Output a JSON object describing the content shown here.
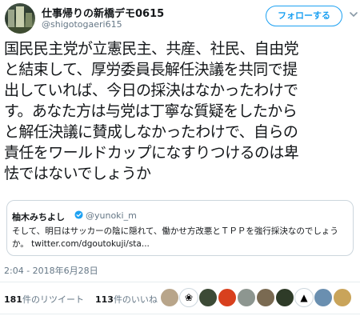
{
  "author": {
    "display_name": "仕事帰りの新橋デモ0615",
    "handle": "@shigotogaeri615"
  },
  "follow_button": {
    "label": "フォローする",
    "accent": "#1da1f2"
  },
  "tweet": {
    "text": "国民民主党が立憲民主、共産、社民、自由党\nと結束して、厚労委員長解任決議を共同で提\n出していれば、今日の採決はなかったわけで\nす。あなた方は与党は丁寧な質疑をしたから\nと解任決議に賛成しなかったわけで、自らの\n責任をワールドカップになすりつけるのは卑\n怯ではないでしょうか"
  },
  "quoted_tweet": {
    "name": "柚木みちよし",
    "handle": "@yunoki_m",
    "text": "そして、明日はサッカーの陰に隠れて、働かせ方改悪とＴＰＰを強行採決なのでしょう\nか。 twitter.com/dgoutokuji/sta..."
  },
  "timestamp": "2:04 - 2018年6月28日",
  "stats": {
    "retweet_count": "181",
    "retweet_label": "件のリツイート",
    "like_count": "113",
    "like_label": "件のいいね"
  },
  "likers": [
    {
      "icon": "liker-avatar-1",
      "color": "#b8a58a"
    },
    {
      "icon": "liker-avatar-paw",
      "color": "#ffffff"
    },
    {
      "icon": "liker-avatar-3",
      "color": "#3c4a36"
    },
    {
      "icon": "liker-avatar-apple",
      "color": "#d8401e"
    },
    {
      "icon": "liker-avatar-5",
      "color": "#8d9690"
    },
    {
      "icon": "liker-avatar-6",
      "color": "#7a6a52"
    },
    {
      "icon": "liker-avatar-7",
      "color": "#2e3b28"
    },
    {
      "icon": "liker-avatar-cat",
      "color": "#ffffff"
    },
    {
      "icon": "liker-avatar-9",
      "color": "#6a8fb0"
    },
    {
      "icon": "liker-avatar-10",
      "color": "#c9a45a"
    }
  ]
}
